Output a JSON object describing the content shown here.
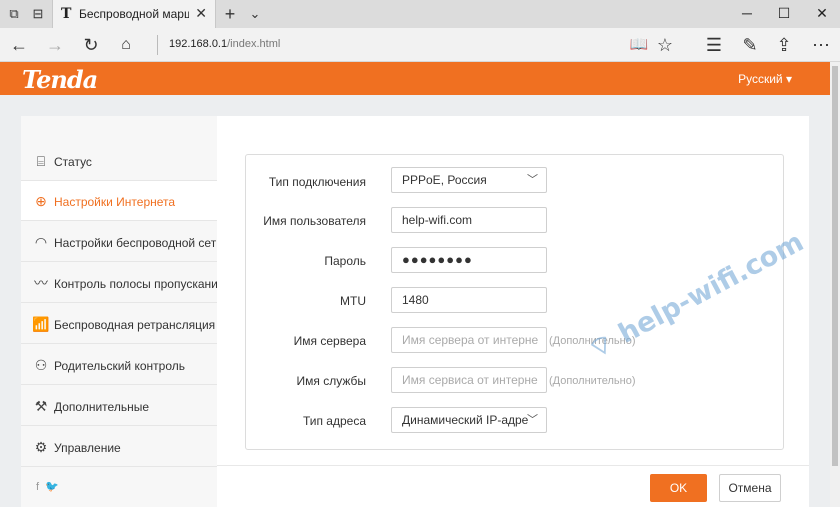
{
  "browser": {
    "tab_title": "Беспроводной маршру",
    "tab_favicon": "T",
    "url_host": "192.168.0.1",
    "url_path": "/index.html",
    "icons": [
      "tab-list-icon",
      "set-aside-icon",
      "close-icon",
      "new-tab-icon",
      "chevron-down-icon",
      "minimize-icon",
      "maximize-icon",
      "window-close-icon",
      "back-icon",
      "forward-icon",
      "refresh-icon",
      "home-icon",
      "reading-view-icon",
      "favorite-star-icon",
      "hub-icon",
      "notes-icon",
      "share-icon",
      "more-icon"
    ]
  },
  "header": {
    "logo": "Tenda",
    "language": "Русский"
  },
  "sidebar": {
    "items": [
      {
        "label": "Статус",
        "icon": "router-icon"
      },
      {
        "label": "Настройки Интернета",
        "icon": "globe-icon"
      },
      {
        "label": "Настройки беспроводной сети",
        "icon": "wifi-icon"
      },
      {
        "label": "Контроль полосы пропускания",
        "icon": "bandwidth-icon"
      },
      {
        "label": "Беспроводная ретрансляция",
        "icon": "antenna-icon"
      },
      {
        "label": "Родительский контроль",
        "icon": "family-icon"
      },
      {
        "label": "Дополнительные",
        "icon": "tools-icon"
      },
      {
        "label": "Управление",
        "icon": "gears-icon"
      }
    ],
    "active_index": 1,
    "social": "f  🐦"
  },
  "form": {
    "connection_type_label": "Тип подключения",
    "connection_type_value": "PPPoE, Россия",
    "username_label": "Имя пользователя",
    "username_value": "help-wifi.com",
    "password_label": "Пароль",
    "password_value": "●●●●●●●●",
    "mtu_label": "MTU",
    "mtu_value": "1480",
    "server_name_label": "Имя сервера",
    "server_name_placeholder": "Имя сервера от интерне",
    "service_name_label": "Имя службы",
    "service_name_placeholder": "Имя сервиса от интерне",
    "optional_text": "(Дополнительно)",
    "address_type_label": "Тип адреса",
    "address_type_value": "Динамический IP-адре"
  },
  "buttons": {
    "ok": "OK",
    "cancel": "Отмена"
  },
  "watermark": "help-wifi.com",
  "colors": {
    "accent": "#f07021",
    "watermark": "#78aad7"
  }
}
